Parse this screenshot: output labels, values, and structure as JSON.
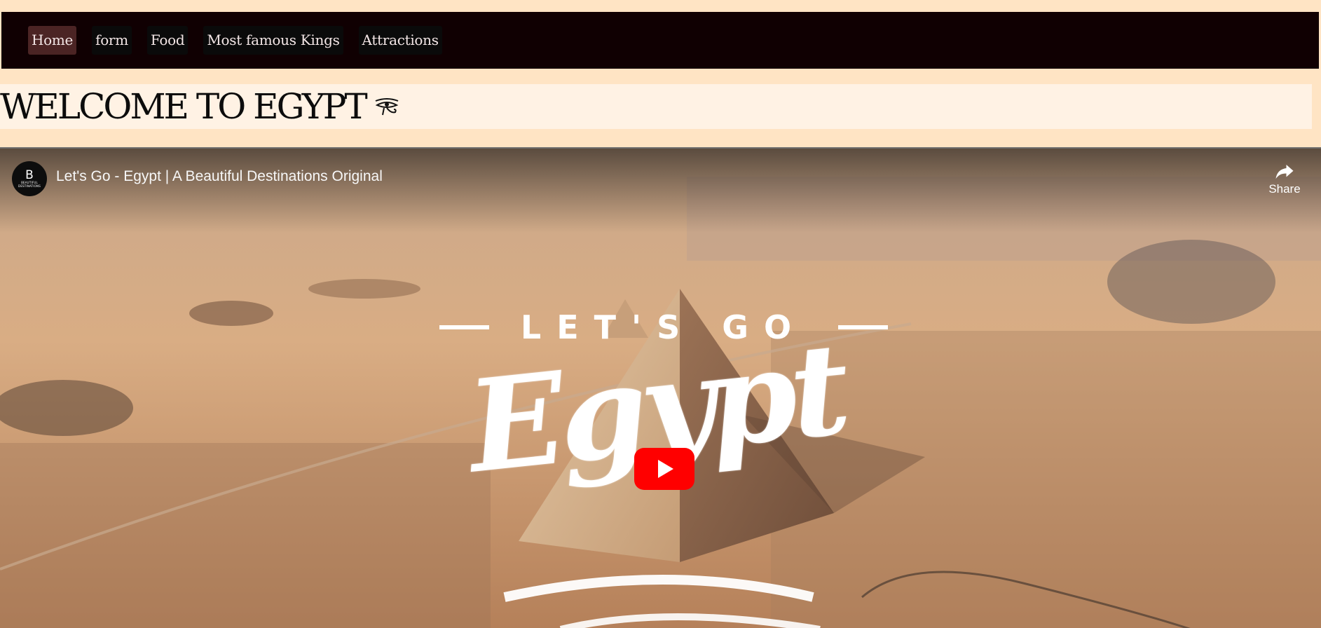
{
  "nav": {
    "items": [
      {
        "label": "Home",
        "active": true
      },
      {
        "label": "form",
        "active": false
      },
      {
        "label": "Food",
        "active": false
      },
      {
        "label": "Most famous Kings",
        "active": false
      },
      {
        "label": "Attractions",
        "active": false
      }
    ]
  },
  "hero": {
    "title": "WELCOME TO EGYPT",
    "icon": "eye-of-horus-icon"
  },
  "video": {
    "channel_initial": "B",
    "channel_subtext": "BEAUTIFUL DESTINATIONS",
    "title": "Let's Go - Egypt | A Beautiful Destinations Original",
    "share_label": "Share",
    "overlay_top": "LET'S GO",
    "overlay_main": "Egypt",
    "play_color": "#ff0000"
  },
  "colors": {
    "page_bg": "#ffe4c4",
    "nav_bg": "#100002",
    "nav_active": "#4b2424",
    "banner_bg": "#fff2e4"
  }
}
